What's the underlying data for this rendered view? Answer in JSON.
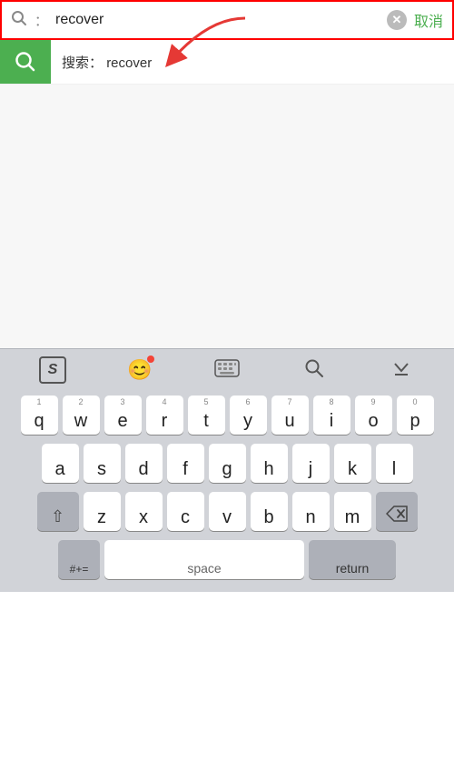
{
  "search_bar": {
    "colon_prefix": "：",
    "input_value": "recover",
    "cancel_label": "取消"
  },
  "suggestion": {
    "prefix": "搜索：",
    "colon": "：",
    "query": " recover"
  },
  "keyboard_toolbar": {
    "btn1_icon": "S",
    "btn2_icon": "😊",
    "btn3_icon": "⌨",
    "btn4_icon": "🔍",
    "btn5_icon": "▽"
  },
  "keyboard": {
    "row1": [
      "q",
      "w",
      "e",
      "r",
      "t",
      "y",
      "u",
      "i",
      "o",
      "p"
    ],
    "row1_nums": [
      "1",
      "2",
      "3",
      "4",
      "5",
      "6",
      "7",
      "8",
      "9",
      "0"
    ],
    "row2": [
      "a",
      "s",
      "d",
      "f",
      "g",
      "h",
      "j",
      "k",
      "l"
    ],
    "row3": [
      "z",
      "x",
      "c",
      "v",
      "b",
      "n",
      "m"
    ],
    "space_label": "space",
    "return_label": "return"
  }
}
